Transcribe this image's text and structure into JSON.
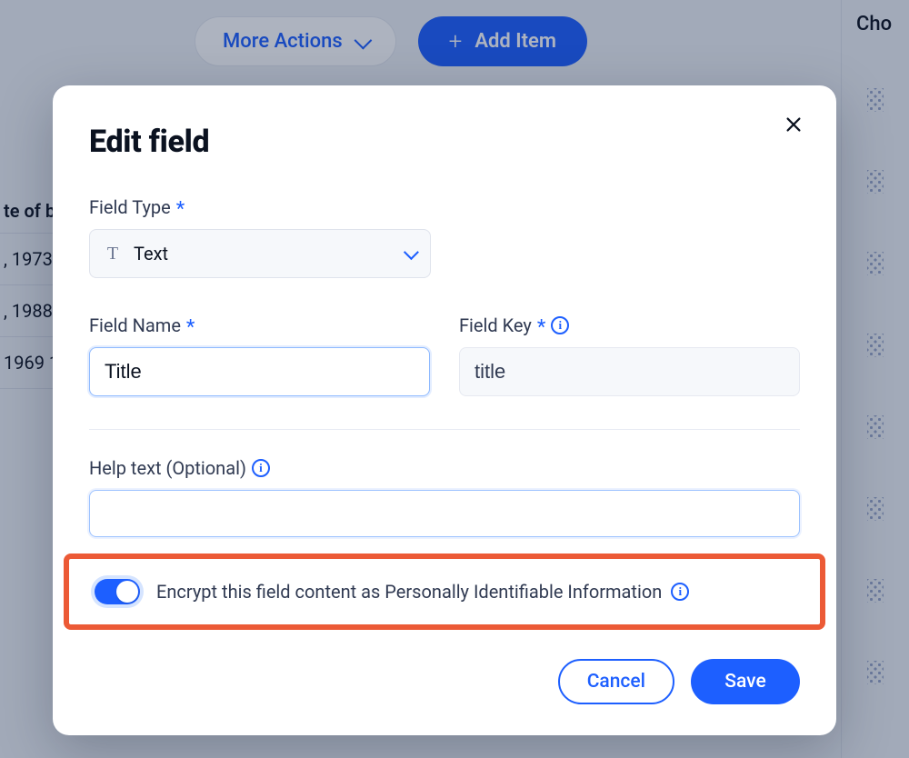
{
  "background": {
    "more_actions_label": "More Actions",
    "add_item_label": "Add Item",
    "table_header": "te of b",
    "rows": [
      ", 1973",
      ", 1988",
      "1969 1"
    ],
    "right_header": "Cho"
  },
  "modal": {
    "title": "Edit field",
    "field_type": {
      "label": "Field Type",
      "required_marker": "*",
      "icon_text": "T",
      "value": "Text"
    },
    "field_name": {
      "label": "Field Name",
      "required_marker": "*",
      "value": "Title"
    },
    "field_key": {
      "label": "Field Key",
      "required_marker": "*",
      "value": "title"
    },
    "help_text": {
      "label": "Help text (Optional)",
      "value": ""
    },
    "encrypt": {
      "label": "Encrypt this field content as Personally Identifiable Information",
      "on": true
    },
    "actions": {
      "cancel": "Cancel",
      "save": "Save"
    }
  }
}
